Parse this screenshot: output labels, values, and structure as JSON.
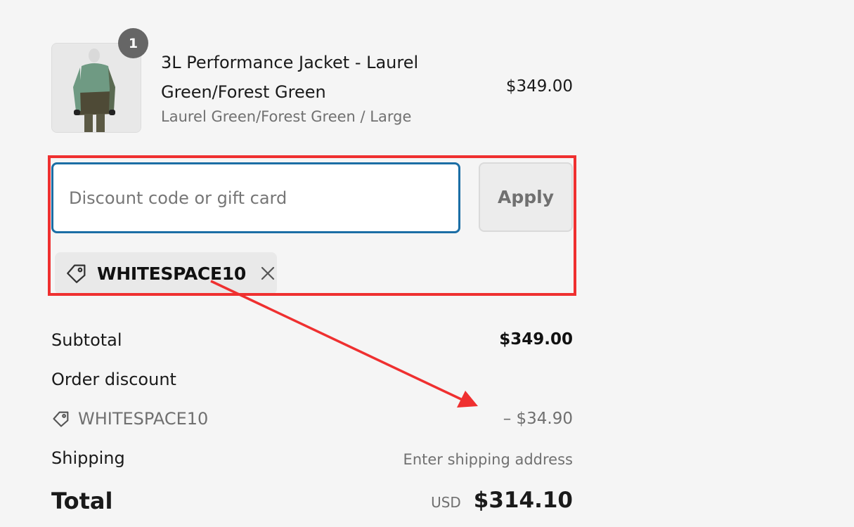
{
  "product": {
    "quantity": "1",
    "name": "3L Performance Jacket - Laurel Green/Forest Green",
    "variant": "Laurel Green/Forest Green / Large",
    "price": "$349.00"
  },
  "discount": {
    "placeholder": "Discount code or gift card",
    "value": "",
    "apply_label": "Apply",
    "applied_code": "WHITESPACE10"
  },
  "summary": {
    "subtotal_label": "Subtotal",
    "subtotal_value": "$349.00",
    "order_discount_label": "Order discount",
    "discount_code": "WHITESPACE10",
    "discount_amount": "– $34.90",
    "shipping_label": "Shipping",
    "shipping_value": "Enter shipping address",
    "total_label": "Total",
    "currency": "USD",
    "total_value": "$314.10"
  },
  "colors": {
    "annotation": "#ef3030",
    "input_focus": "#1b6ea5",
    "background": "#f5f5f5"
  }
}
